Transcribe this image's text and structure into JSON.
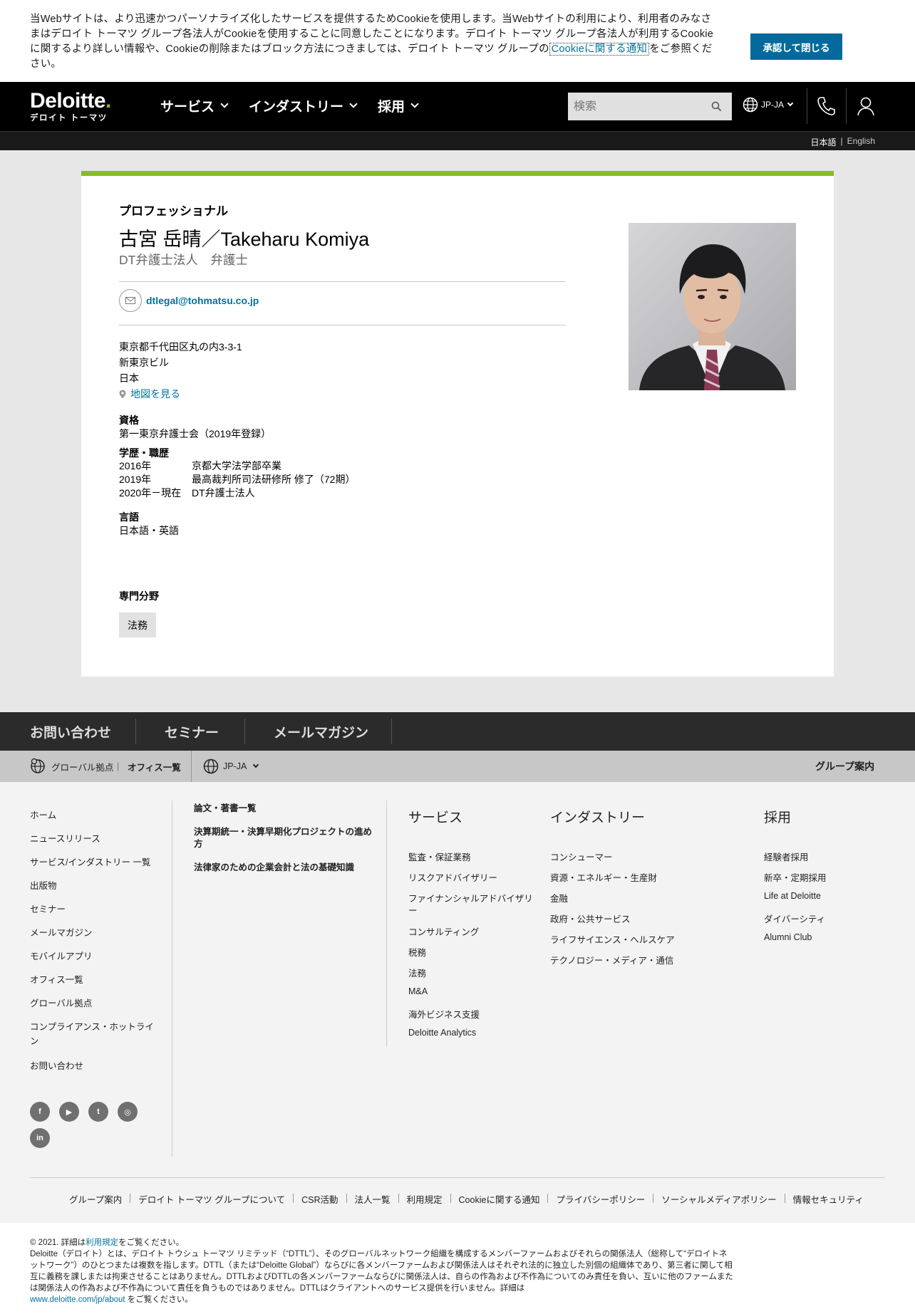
{
  "cookie": {
    "text_before_link": "当Webサイトは、より迅速かつパーソナライズ化したサービスを提供するためCookieを使用します。当Webサイトの利用により、利用者のみなさまはデロイト トーマツ グループ各法人がCookieを使用することに同意したことになります。デロイト トーマツ グループ各法人が利用するCookieに関するより詳しい情報や、Cookieの削除またはブロック方法につきましては、デロイト トーマツ グループの",
    "link_text": "Cookieに関する通知",
    "text_after_link": "をご参照ください。",
    "accept_button": "承認して閉じる"
  },
  "header": {
    "logo_main": "Deloitte",
    "logo_dot": ".",
    "logo_sub": "デロイト トーマツ",
    "nav": [
      "サービス",
      "インダストリー",
      "採用"
    ],
    "search_placeholder": "検索",
    "locale": "JP-JA"
  },
  "subbar": {
    "lang_ja": "日本語",
    "sep": "|",
    "lang_en": "English"
  },
  "profile": {
    "eyebrow": "プロフェッショナル",
    "name": "古宮 岳晴／Takeharu Komiya",
    "title": "DT弁護士法人　弁護士",
    "email": "dtlegal@tohmatsu.co.jp",
    "address": [
      "東京都千代田区丸の内3-3-1",
      "新東京ビル",
      "日本"
    ],
    "map_link": "地図を見る",
    "qualification_heading": "資格",
    "qualification": "第一東京弁護士会（2019年登録）",
    "career_heading": "学歴・職歴",
    "career": [
      {
        "year": "2016年",
        "desc": "京都大学法学部卒業"
      },
      {
        "year": "2019年",
        "desc": "最高裁判所司法研修所 修了（72期）"
      },
      {
        "year": "2020年－現在",
        "desc": "DT弁護士法人"
      }
    ],
    "language_heading": "言語",
    "language": "日本語・英語",
    "specialty_heading": "専門分野",
    "specialty_tag": "法務"
  },
  "footer_tabs": [
    "お問い合わせ",
    "セミナー",
    "メールマガジン"
  ],
  "footer_bar": {
    "global": "グローバル拠点",
    "sep": "|",
    "offices": "オフィス一覧",
    "locale": "JP-JA",
    "group": "グループ案内"
  },
  "footer_col1": [
    "ホーム",
    "ニュースリリース",
    "サービス/インダストリー 一覧",
    "出版物",
    "セミナー",
    "メールマガジン",
    "モバイルアプリ",
    "オフィス一覧",
    "グローバル拠点",
    "コンプライアンス・ホットライ",
    "ン",
    "お問い合わせ"
  ],
  "footer_col2": [
    "論文・著書一覧",
    "決算期統一・決算早期化プロジェクトの進め",
    "方",
    "法律家のための企業会計と法の基礎知識"
  ],
  "footer_services": {
    "heading": "サービス",
    "items": [
      "監査・保証業務",
      "リスクアドバイザリー",
      "ファイナンシャルアドバイザリ",
      "ー",
      "コンサルティング",
      "税務",
      "法務",
      "M&A",
      "海外ビジネス支援",
      "Deloitte Analytics"
    ]
  },
  "footer_industry": {
    "heading": "インダストリー",
    "items": [
      "コンシューマー",
      "資源・エネルギー・生産財",
      "金融",
      "政府・公共サービス",
      "ライフサイエンス・ヘルスケア",
      "テクノロジー・メディア・通信"
    ]
  },
  "footer_recruit": {
    "heading": "採用",
    "items": [
      "経験者採用",
      "新卒・定期採用",
      "Life at Deloitte",
      "ダイバーシティ",
      "Alumni Club"
    ]
  },
  "social": [
    "f",
    "▶",
    "t",
    "◎",
    "in"
  ],
  "bottom_links": [
    "グループ案内",
    "デロイト トーマツ グループについて",
    "CSR活動",
    "法人一覧",
    "利用規定",
    "Cookieに関する通知",
    "プライバシーポリシー",
    "ソーシャルメディアポリシー",
    "情報セキュリティ"
  ],
  "legal": {
    "line1_before": "© 2021. 詳細は",
    "line1_link": "利用規定",
    "line1_after": "をご覧ください。",
    "body": "Deloitte（デロイト）とは、デロイト トウシュ トーマツ リミテッド（“DTTL”）、そのグローバルネットワーク組織を構成するメンバーファームおよびそれらの関係法人（総称して“デロイトネットワーク”）のひとつまたは複数を指します。DTTL（または“Deloitte Global”）ならびに各メンバーファームおよび関係法人はそれぞれ法的に独立した別個の組織体であり、第三者に関して相互に義務を課しまたは拘束させることはありません。DTTLおよびDTTLの各メンバーファームならびに関係法人は、自らの作為および不作為についてのみ責任を負い、互いに他のファームまたは関係法人の作為および不作為について責任を負うものではありません。DTTLはクライアントへのサービス提供を行いません。詳細は",
    "url": "www.deloitte.com/jp/about",
    "url_after": " をご覧ください。"
  },
  "colors": {
    "accent_green": "#86bc25",
    "link_blue": "#00739d",
    "button_blue": "#046a9b"
  }
}
